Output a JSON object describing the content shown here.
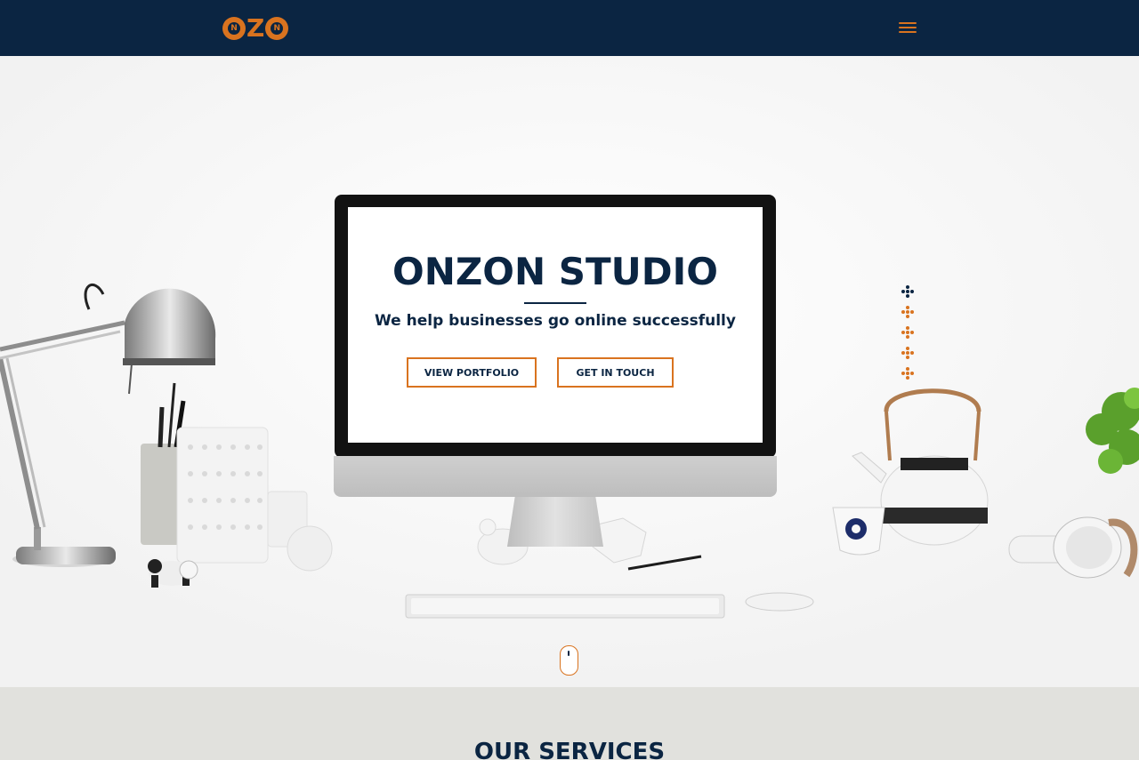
{
  "header": {
    "logo_text": "ONZON",
    "logo_letter_n": "N",
    "logo_letter_z": "Z",
    "menu_icon": "hamburger-menu-icon"
  },
  "hero": {
    "title": "ONZON STUDIO",
    "subtitle": "We help businesses go online successfully",
    "buttons": {
      "portfolio": "VIEW PORTFOLIO",
      "contact": "GET IN TOUCH"
    },
    "scroll_icon": "mouse-scroll-icon"
  },
  "services": {
    "title": "OUR SERVICES"
  },
  "colors": {
    "navy": "#0b2542",
    "accent_orange": "#d9731f",
    "services_bg": "#e1e1dd"
  }
}
